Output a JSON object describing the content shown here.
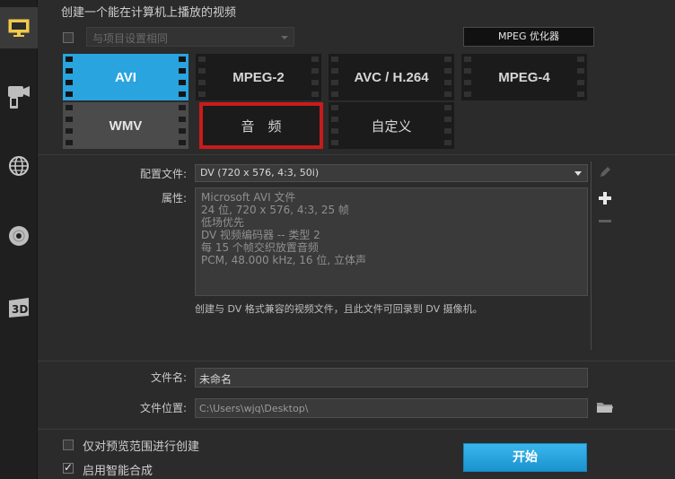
{
  "header": {
    "title": "创建一个能在计算机上播放的视频"
  },
  "project_settings": {
    "checkbox_label": "与项目设置相同",
    "checked": false
  },
  "mpeg_optimizer": {
    "label": "MPEG 优化器"
  },
  "formats": [
    {
      "label": "AVI",
      "state": "selected"
    },
    {
      "label": "MPEG-2",
      "state": "normal"
    },
    {
      "label": "AVC / H.264",
      "state": "normal"
    },
    {
      "label": "MPEG-4",
      "state": "normal"
    },
    {
      "label": "WMV",
      "state": "gray"
    },
    {
      "label": "音　频",
      "state": "highlighted"
    },
    {
      "label": "自定义",
      "state": "normal"
    }
  ],
  "profile": {
    "label": "配置文件:",
    "value": "DV (720 x 576, 4:3, 50i)"
  },
  "properties": {
    "label": "属性:",
    "lines": [
      "Microsoft AVI 文件",
      "24 位, 720 x 576, 4:3, 25 帧",
      "低场优先",
      "DV 视频编码器 -- 类型 2",
      "每 15 个帧交织放置音频",
      "PCM, 48.000 kHz, 16 位, 立体声"
    ]
  },
  "description": "创建与 DV 格式兼容的视频文件，且此文件可回录到 DV 摄像机。",
  "file": {
    "name_label": "文件名:",
    "name_value": "未命名",
    "location_label": "文件位置:",
    "location_value": "C:\\Users\\wjq\\Desktop\\"
  },
  "options": {
    "preview_range_label": "仅对预览范围进行创建",
    "preview_range_checked": false,
    "smart_render_label": "启用智能合成",
    "smart_render_checked": true
  },
  "start_button": {
    "label": "开始"
  },
  "colors": {
    "accent": "#29a4df",
    "highlight": "#c91b1b",
    "background": "#2b2b2b"
  }
}
